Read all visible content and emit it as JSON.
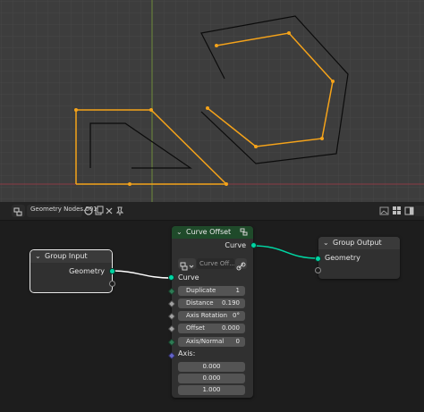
{
  "header": {
    "tree_name": "Geometry Nodes.001",
    "icons": [
      "node-tree-icon",
      "shield-icon",
      "duplicate-icon",
      "close-icon",
      "pin-icon",
      "image-icon",
      "grid-icon",
      "sidebar-icon"
    ]
  },
  "nodes": {
    "group_input": {
      "title": "Group Input",
      "output_geometry": "Geometry"
    },
    "curve_offset": {
      "title": "Curve Offset",
      "output_curve": "Curve",
      "selector_value": "Curve Off...",
      "input_curve": "Curve",
      "duplicate_label": "Duplicate",
      "duplicate_value": "1",
      "distance_label": "Distance",
      "distance_value": "0.190",
      "axis_rotation_label": "Axis Rotation",
      "axis_rotation_value": "0°",
      "offset_label": "Offset",
      "offset_value": "0.000",
      "axis_normal_label": "Axis/Normal",
      "axis_normal_value": "0",
      "axis_label": "Axis:",
      "axis_x": "0.000",
      "axis_y": "0.000",
      "axis_z": "1.000"
    },
    "group_output": {
      "title": "Group Output",
      "input_geometry": "Geometry"
    }
  },
  "colors": {
    "viewport_bg": "#3d3d3d",
    "curve_selected": "#f5a31a",
    "curve_unselected": "#0b0b0b",
    "geometry_socket": "#00d6a3",
    "node_header_default": "#3a3a3a",
    "node_header_curve_offset": "#1f4a2a"
  }
}
